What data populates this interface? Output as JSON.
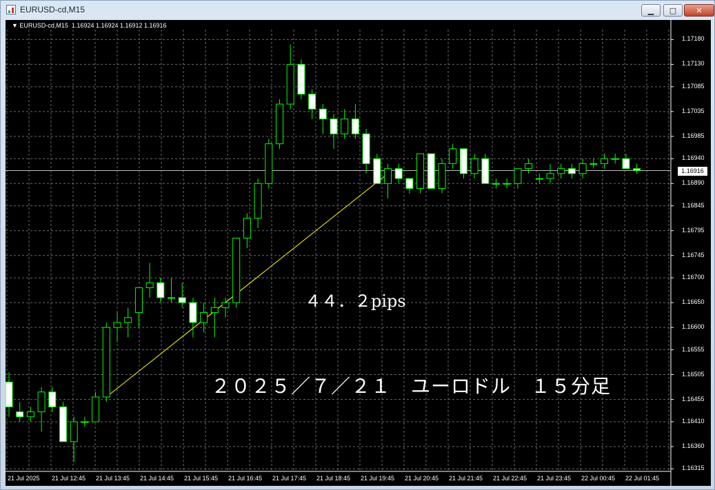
{
  "window": {
    "title": "EURUSD-cd,M15",
    "buttons": [
      {
        "name": "minimize",
        "glyph": "▁"
      },
      {
        "name": "maximize",
        "glyph": "□"
      },
      {
        "name": "close",
        "glyph": "✕"
      }
    ]
  },
  "chart": {
    "header": "▼ EURUSD-cd,M15  1.16924 1.16924 1.16912 1.16916",
    "bid_label": "1.16916",
    "annotation_pips": "４４．２pips",
    "annotation_title": "２０２５／７／２１　ユーロドル　１５分足",
    "colors": {
      "background": "#000000",
      "grid": "#6b6b6b",
      "bull_body": "#000000",
      "bear_body": "#ffffff",
      "candle_outline": "#00ff00",
      "trendline": "#ffff00",
      "bid_line": "#c0c0c0"
    }
  },
  "chart_data": {
    "type": "candlestick",
    "symbol": "EURUSD-cd",
    "timeframe": "M15",
    "ylim": [
      1.1631,
      1.172
    ],
    "y_ticks": [
      "1.17180",
      "1.17130",
      "1.17085",
      "1.17035",
      "1.16985",
      "1.16940",
      "1.16890",
      "1.16845",
      "1.16795",
      "1.16745",
      "1.16700",
      "1.16650",
      "1.16600",
      "1.16555",
      "1.16505",
      "1.16455",
      "1.16410",
      "1.16360",
      "1.16315"
    ],
    "x_ticks": [
      "21 Jul 2025",
      "21 Jul 12:45",
      "21 Jul 13:45",
      "21 Jul 14:45",
      "21 Jul 15:45",
      "21 Jul 16:45",
      "21 Jul 17:45",
      "21 Jul 18:45",
      "21 Jul 19:45",
      "21 Jul 20:45",
      "21 Jul 21:45",
      "21 Jul 22:45",
      "21 Jul 23:45",
      "22 Jul 00:45",
      "22 Jul 01:45"
    ],
    "bid": 1.16916,
    "candles": [
      [
        1.1649,
        1.1651,
        1.1642,
        1.1644
      ],
      [
        1.1643,
        1.1645,
        1.1641,
        1.1642
      ],
      [
        1.1642,
        1.1644,
        1.1641,
        1.1643
      ],
      [
        1.1643,
        1.1648,
        1.1639,
        1.1647
      ],
      [
        1.1647,
        1.1648,
        1.1643,
        1.1644
      ],
      [
        1.1644,
        1.1645,
        1.1637,
        1.1637
      ],
      [
        1.1637,
        1.1642,
        1.1633,
        1.1641
      ],
      [
        1.1641,
        1.1642,
        1.164,
        1.1641
      ],
      [
        1.1641,
        1.1647,
        1.1641,
        1.1646
      ],
      [
        1.1646,
        1.1661,
        1.1645,
        1.166
      ],
      [
        1.166,
        1.1663,
        1.1657,
        1.1661
      ],
      [
        1.1661,
        1.1664,
        1.1658,
        1.1662
      ],
      [
        1.1663,
        1.1668,
        1.166,
        1.1668
      ],
      [
        1.1668,
        1.1673,
        1.1666,
        1.1669
      ],
      [
        1.1669,
        1.167,
        1.1665,
        1.1666
      ],
      [
        1.1666,
        1.167,
        1.1665,
        1.1666
      ],
      [
        1.1666,
        1.1669,
        1.1664,
        1.1665
      ],
      [
        1.1665,
        1.1666,
        1.1658,
        1.1661
      ],
      [
        1.1661,
        1.1665,
        1.1659,
        1.1663
      ],
      [
        1.1663,
        1.1666,
        1.1658,
        1.1664
      ],
      [
        1.1664,
        1.1666,
        1.1662,
        1.1665
      ],
      [
        1.1665,
        1.1678,
        1.1664,
        1.1678
      ],
      [
        1.1678,
        1.1683,
        1.1676,
        1.1682
      ],
      [
        1.1682,
        1.169,
        1.168,
        1.1689
      ],
      [
        1.1689,
        1.1698,
        1.1688,
        1.1697
      ],
      [
        1.1697,
        1.1706,
        1.1696,
        1.1705
      ],
      [
        1.1705,
        1.1717,
        1.1704,
        1.1713
      ],
      [
        1.1713,
        1.1714,
        1.1706,
        1.1707
      ],
      [
        1.1707,
        1.1708,
        1.1702,
        1.1704
      ],
      [
        1.1704,
        1.1705,
        1.1699,
        1.1702
      ],
      [
        1.1702,
        1.1703,
        1.1696,
        1.1699
      ],
      [
        1.1699,
        1.1704,
        1.1698,
        1.1702
      ],
      [
        1.1702,
        1.1705,
        1.1698,
        1.1699
      ],
      [
        1.1699,
        1.17,
        1.1691,
        1.1693
      ],
      [
        1.1694,
        1.1695,
        1.1689,
        1.1689
      ],
      [
        1.1689,
        1.1693,
        1.1686,
        1.1692
      ],
      [
        1.1692,
        1.1693,
        1.1689,
        1.169
      ],
      [
        1.169,
        1.169,
        1.1687,
        1.1688
      ],
      [
        1.1688,
        1.1695,
        1.1687,
        1.1695
      ],
      [
        1.1695,
        1.1695,
        1.1688,
        1.1688
      ],
      [
        1.1688,
        1.1694,
        1.1687,
        1.1693
      ],
      [
        1.1693,
        1.1697,
        1.1692,
        1.1696
      ],
      [
        1.1696,
        1.1696,
        1.169,
        1.1691
      ],
      [
        1.1691,
        1.1695,
        1.169,
        1.1694
      ],
      [
        1.1694,
        1.1695,
        1.1689,
        1.1689
      ],
      [
        1.1689,
        1.169,
        1.1688,
        1.1689
      ],
      [
        1.1689,
        1.169,
        1.1688,
        1.1689
      ],
      [
        1.1689,
        1.1692,
        1.1688,
        1.1692
      ],
      [
        1.1692,
        1.1694,
        1.1691,
        1.1693
      ],
      [
        1.169,
        1.1691,
        1.1689,
        1.169
      ],
      [
        1.169,
        1.1693,
        1.1689,
        1.1691
      ],
      [
        1.1691,
        1.1693,
        1.169,
        1.1692
      ],
      [
        1.1692,
        1.1693,
        1.169,
        1.1691
      ],
      [
        1.1691,
        1.1694,
        1.169,
        1.1693
      ],
      [
        1.1693,
        1.1694,
        1.1692,
        1.1693
      ],
      [
        1.1693,
        1.1695,
        1.1692,
        1.1694
      ],
      [
        1.1694,
        1.1695,
        1.1693,
        1.1694
      ],
      [
        1.1694,
        1.1695,
        1.1692,
        1.1692
      ],
      [
        1.1692,
        1.1693,
        1.1691,
        1.16916
      ]
    ],
    "trendline": {
      "from": {
        "candle": 9,
        "price": 1.1646
      },
      "to": {
        "candle": 35,
        "price": 1.1691
      }
    }
  }
}
